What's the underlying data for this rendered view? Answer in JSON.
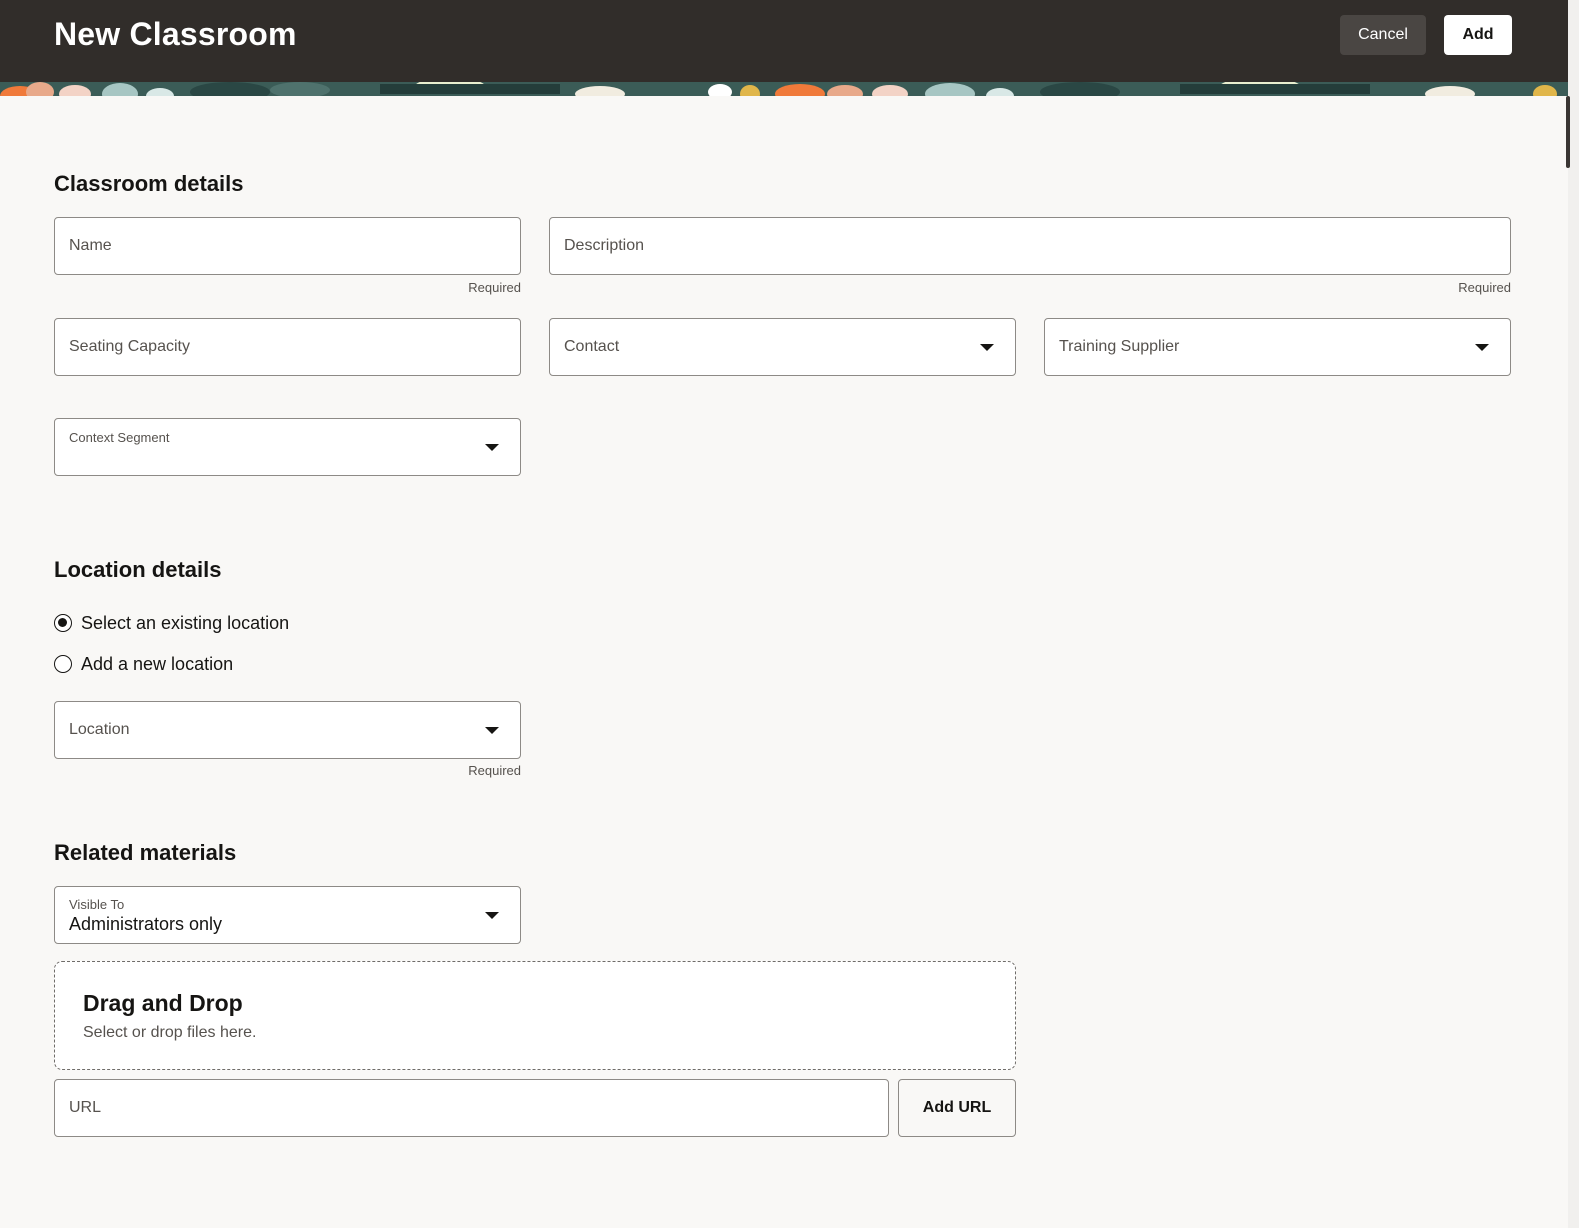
{
  "header": {
    "title": "New Classroom",
    "cancel_label": "Cancel",
    "add_label": "Add"
  },
  "classroom": {
    "section_title": "Classroom details",
    "name_label": "Name",
    "name_helper": "Required",
    "description_label": "Description",
    "description_helper": "Required",
    "seating_label": "Seating Capacity",
    "contact_label": "Contact",
    "supplier_label": "Training Supplier",
    "context_label": "Context Segment"
  },
  "location": {
    "section_title": "Location details",
    "options": [
      {
        "label": "Select an existing location",
        "checked": true
      },
      {
        "label": "Add a new location",
        "checked": false
      }
    ],
    "location_label": "Location",
    "location_helper": "Required"
  },
  "materials": {
    "section_title": "Related materials",
    "visible_label": "Visible To",
    "visible_value": "Administrators only",
    "dropzone_title": "Drag and Drop",
    "dropzone_sub": "Select or drop files here.",
    "url_label": "URL",
    "add_url_label": "Add URL"
  },
  "colors": {
    "header_bg": "#312d2a",
    "page_bg": "#f9f8f6",
    "border": "#8d8a86"
  }
}
